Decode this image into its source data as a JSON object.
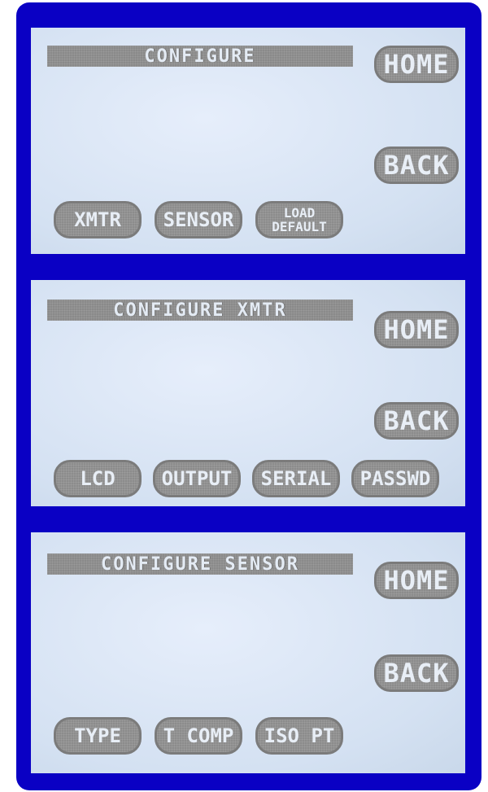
{
  "screens": [
    {
      "title": "CONFIGURE",
      "home_label": "HOME",
      "back_label": "BACK",
      "bottom_buttons": [
        {
          "label": "XMTR"
        },
        {
          "label": "SENSOR"
        },
        {
          "label_line1": "LOAD",
          "label_line2": "DEFAULT"
        }
      ]
    },
    {
      "title": "CONFIGURE XMTR",
      "home_label": "HOME",
      "back_label": "BACK",
      "bottom_buttons": [
        {
          "label": "LCD"
        },
        {
          "label": "OUTPUT"
        },
        {
          "label": "SERIAL"
        },
        {
          "label": "PASSWD"
        }
      ]
    },
    {
      "title": "CONFIGURE SENSOR",
      "home_label": "HOME",
      "back_label": "BACK",
      "bottom_buttons": [
        {
          "label": "TYPE"
        },
        {
          "label": "T COMP"
        },
        {
          "label": "ISO PT"
        }
      ]
    }
  ],
  "colors": {
    "bezel": "#0a00c4",
    "screen": "#d9e6f4",
    "button": "#8c8c8c",
    "button_text": "#e8eef6"
  }
}
